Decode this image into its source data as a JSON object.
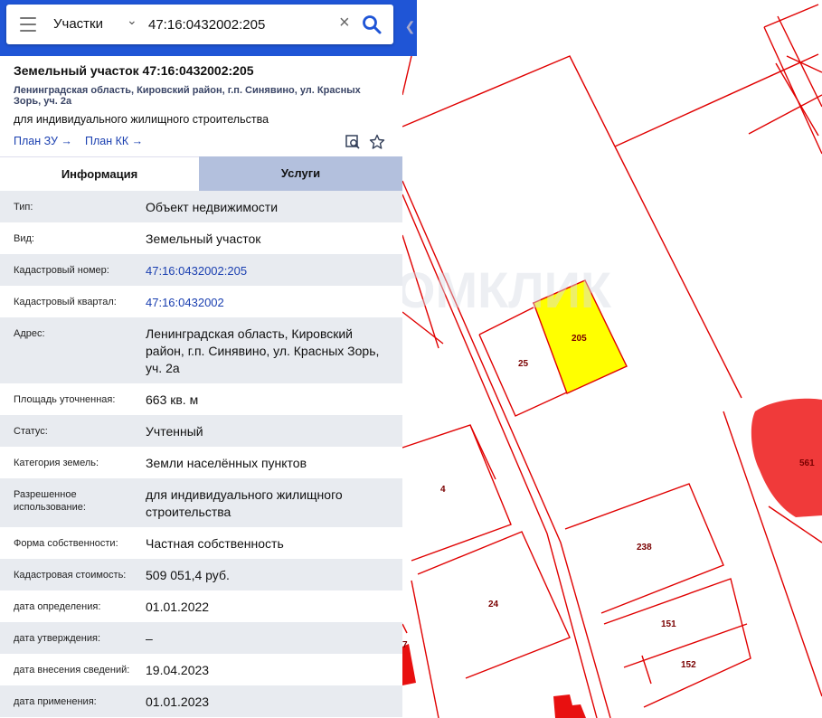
{
  "search": {
    "category": "Участки",
    "query": "47:16:0432002:205"
  },
  "card": {
    "title": "Земельный участок 47:16:0432002:205",
    "address": "Ленинградская область, Кировский район, г.п. Синявино, ул. Красных Зорь, уч. 2а",
    "use": "для индивидуального жилищного строительства",
    "links": [
      "План ЗУ →",
      "План КК →"
    ]
  },
  "tabs": [
    {
      "label": "Информация",
      "active": true
    },
    {
      "label": "Услуги",
      "active": false
    }
  ],
  "info_rows": [
    {
      "label": "Тип:",
      "value": "Объект недвижимости"
    },
    {
      "label": "Вид:",
      "value": "Земельный участок"
    },
    {
      "label": "Кадастровый номер:",
      "value": "47:16:0432002:205",
      "link": true
    },
    {
      "label": "Кадастровый квартал:",
      "value": "47:16:0432002",
      "link": true
    },
    {
      "label": "Адрес:",
      "value": "Ленинградская область, Кировский район, г.п. Синявино, ул. Красных Зорь, уч. 2а"
    },
    {
      "label": "Площадь уточненная:",
      "value": "663 кв. м"
    },
    {
      "label": "Статус:",
      "value": "Учтенный"
    },
    {
      "label": "Категория земель:",
      "value": "Земли населённых пунктов"
    },
    {
      "label": "Разрешенное использование:",
      "value": "для индивидуального жилищного строительства"
    },
    {
      "label": "Форма собственности:",
      "value": "Частная собственность"
    },
    {
      "label": "Кадастровая стоимость:",
      "value": "509 051,4 руб."
    },
    {
      "label": "дата определения:",
      "value": "01.01.2022"
    },
    {
      "label": "дата утверждения:",
      "value": "–"
    },
    {
      "label": "дата внесения сведений:",
      "value": "19.04.2023"
    },
    {
      "label": "дата применения:",
      "value": "01.01.2023"
    }
  ],
  "map": {
    "parcel_labels": [
      "205",
      "25",
      "4",
      "24",
      "238",
      "151",
      "152",
      "561",
      "7"
    ],
    "watermark": "ДОМКЛИК",
    "colors": {
      "boundary": "#e00000",
      "selected": "#ffff00",
      "filled": "#f03a3a",
      "accent": "#1f55d6"
    }
  }
}
